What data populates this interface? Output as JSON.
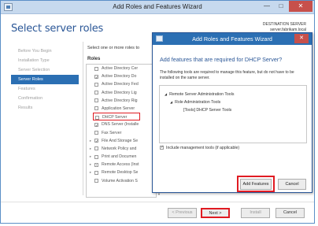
{
  "window": {
    "title": "Add Roles and Features Wizard",
    "minimize_glyph": "—",
    "maximize_glyph": "□",
    "close_glyph": "✕"
  },
  "page": {
    "title": "Select server roles",
    "destination_label": "DESTINATION SERVER",
    "destination_value": "server.fabrikam.local"
  },
  "nav": {
    "items": [
      {
        "label": "Before You Begin",
        "active": false
      },
      {
        "label": "Installation Type",
        "active": false
      },
      {
        "label": "Server Selection",
        "active": false
      },
      {
        "label": "Server Roles",
        "active": true
      },
      {
        "label": "Features",
        "active": false
      },
      {
        "label": "Confirmation",
        "active": false
      },
      {
        "label": "Results",
        "active": false
      }
    ]
  },
  "roles": {
    "intro": "Select one or more roles to",
    "header": "Roles",
    "items": [
      {
        "label": "Active Directory Cer",
        "checked": false,
        "expander": ""
      },
      {
        "label": "Active Directory Do",
        "checked": true,
        "expander": ""
      },
      {
        "label": "Active Directory Fed",
        "checked": false,
        "expander": ""
      },
      {
        "label": "Active Directory Lig",
        "checked": false,
        "expander": ""
      },
      {
        "label": "Active Directory Rig",
        "checked": false,
        "expander": ""
      },
      {
        "label": "Application Server",
        "checked": false,
        "expander": ""
      },
      {
        "label": "DHCP Server",
        "checked": false,
        "expander": "",
        "highlighted": true
      },
      {
        "label": "DNS Server (Installe",
        "checked": true,
        "expander": ""
      },
      {
        "label": "Fax Server",
        "checked": false,
        "expander": ""
      },
      {
        "label": "File And Storage Se",
        "checked": true,
        "expander": "▸"
      },
      {
        "label": "Network Policy and",
        "checked": false,
        "expander": "▸"
      },
      {
        "label": "Print and Documen",
        "checked": false,
        "expander": "▸"
      },
      {
        "label": "Remote Access (Inst",
        "checked": false,
        "expander": "▸"
      },
      {
        "label": "Remote Desktop Se",
        "checked": false,
        "expander": "▸"
      },
      {
        "label": "Volume Activation S",
        "checked": false,
        "expander": ""
      }
    ]
  },
  "footer": {
    "previous": "< Previous",
    "next": "Next >",
    "install": "Install",
    "cancel": "Cancel"
  },
  "dialog": {
    "title": "Add Roles and Features Wizard",
    "close_glyph": "✕",
    "question": "Add features that are required for DHCP Server?",
    "description": "The following tools are required to manage this feature, but do not have to be installed on the same server.",
    "tree": [
      {
        "label": "Remote Server Administration Tools",
        "level": 0,
        "arrow": "◢"
      },
      {
        "label": "Role Administration Tools",
        "level": 1,
        "arrow": "◢"
      },
      {
        "label": "[Tools] DHCP Server Tools",
        "level": 2,
        "arrow": ""
      }
    ],
    "include_label": "Include management tools (if applicable)",
    "add_features": "Add Features",
    "cancel": "Cancel"
  },
  "colors": {
    "accent": "#2b6fb3",
    "title_blue": "#2b5797",
    "highlight_red": "#e01b22"
  }
}
